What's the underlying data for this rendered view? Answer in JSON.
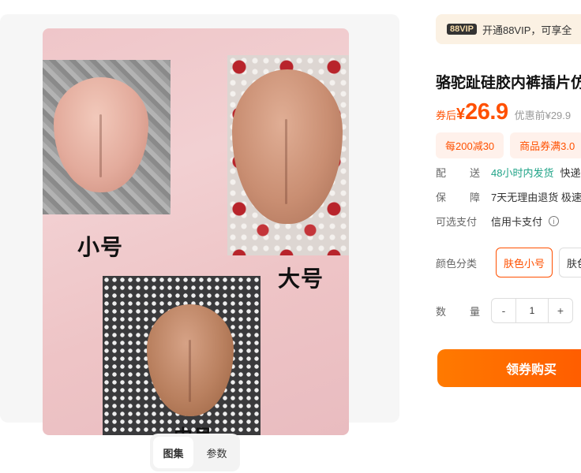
{
  "gallery": {
    "labels": {
      "small": "小号",
      "large": "大号",
      "medium": "中号"
    },
    "tabs": [
      {
        "label": "图集"
      },
      {
        "label": "参数"
      }
    ]
  },
  "vip": {
    "badge": "88VIP",
    "text": "开通88VIP，可享全"
  },
  "product": {
    "title": "骆驼趾硅胶内裤插片仿",
    "price": {
      "prefix": "券后",
      "currency": "¥",
      "value": "26.9",
      "original": "优惠前¥29.9"
    }
  },
  "coupons": [
    {
      "label": "每200减30"
    },
    {
      "label": "商品券满3.0"
    }
  ],
  "details": {
    "shipping": {
      "label_a": "配",
      "label_b": "送",
      "value_highlight": "48小时内发货",
      "value_rest": "快递"
    },
    "guarantee": {
      "label_a": "保",
      "label_b": "障",
      "value": "7天无理由退货 极速"
    },
    "payment": {
      "label": "可选支付",
      "value": "信用卡支付",
      "info_icon": "ⓘ"
    }
  },
  "sku": {
    "label": "颜色分类",
    "options": [
      {
        "label": "肤色小号",
        "selected": true
      },
      {
        "label": "肤色"
      }
    ]
  },
  "quantity": {
    "label_a": "数",
    "label_b": "量",
    "minus": "-",
    "value": "1",
    "plus": "+"
  },
  "actions": {
    "buy_label": "领券购买"
  },
  "colors": {
    "accent": "#ff5000",
    "shipping_green": "#1fa387",
    "vip_bg": "#fbf1e3"
  }
}
